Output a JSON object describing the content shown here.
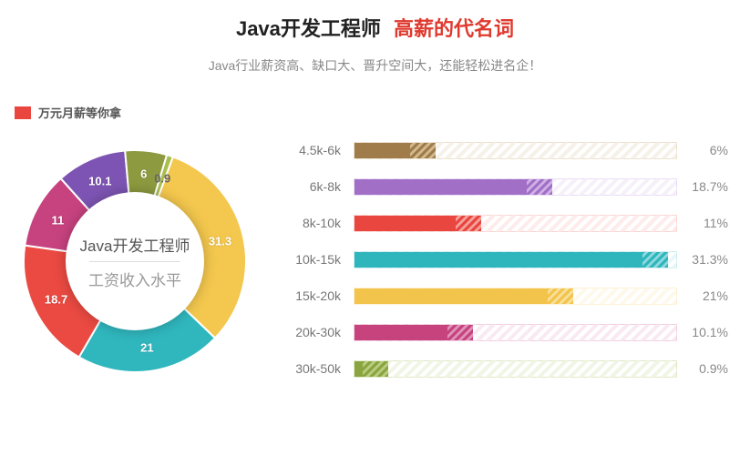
{
  "header": {
    "title_black": "Java开发工程师",
    "title_red": "高薪的代名词",
    "subtitle": "Java行业薪资高、缺口大、晋升空间大，还能轻松进名企！"
  },
  "tag": {
    "label": "万元月薪等你拿"
  },
  "donut": {
    "center_line1": "Java开发工程师",
    "center_line2": "工资收入水平"
  },
  "chart_data": {
    "type": "pie+bar",
    "title": "Java开发工程师 工资收入水平",
    "categories": [
      "4.5k-6k",
      "6k-8k",
      "8k-10k",
      "10k-15k",
      "15k-20k",
      "20k-30k",
      "30k-50k"
    ],
    "values": [
      6,
      18.7,
      11,
      31.3,
      21,
      10.1,
      0.9
    ],
    "display_pct": [
      "6%",
      "18.7%",
      "11%",
      "31.3%",
      "21%",
      "10.1%",
      "0.9%"
    ],
    "donut_labels": [
      "6",
      "18.7",
      "11",
      "31.3",
      "21",
      "10.1",
      "0.9"
    ],
    "colors": [
      "#a07c4b",
      "#a170c6",
      "#e9463f",
      "#2fb6bd",
      "#f3c44b",
      "#c6437e",
      "#8aa540"
    ],
    "colors_light": [
      "#d2b98f",
      "#cfb1e6",
      "#f4a19c",
      "#8ed9de",
      "#f8df9a",
      "#e093ba",
      "#b9cc80"
    ],
    "xlabel": "",
    "ylabel": "",
    "ylim": [
      0,
      100
    ]
  }
}
